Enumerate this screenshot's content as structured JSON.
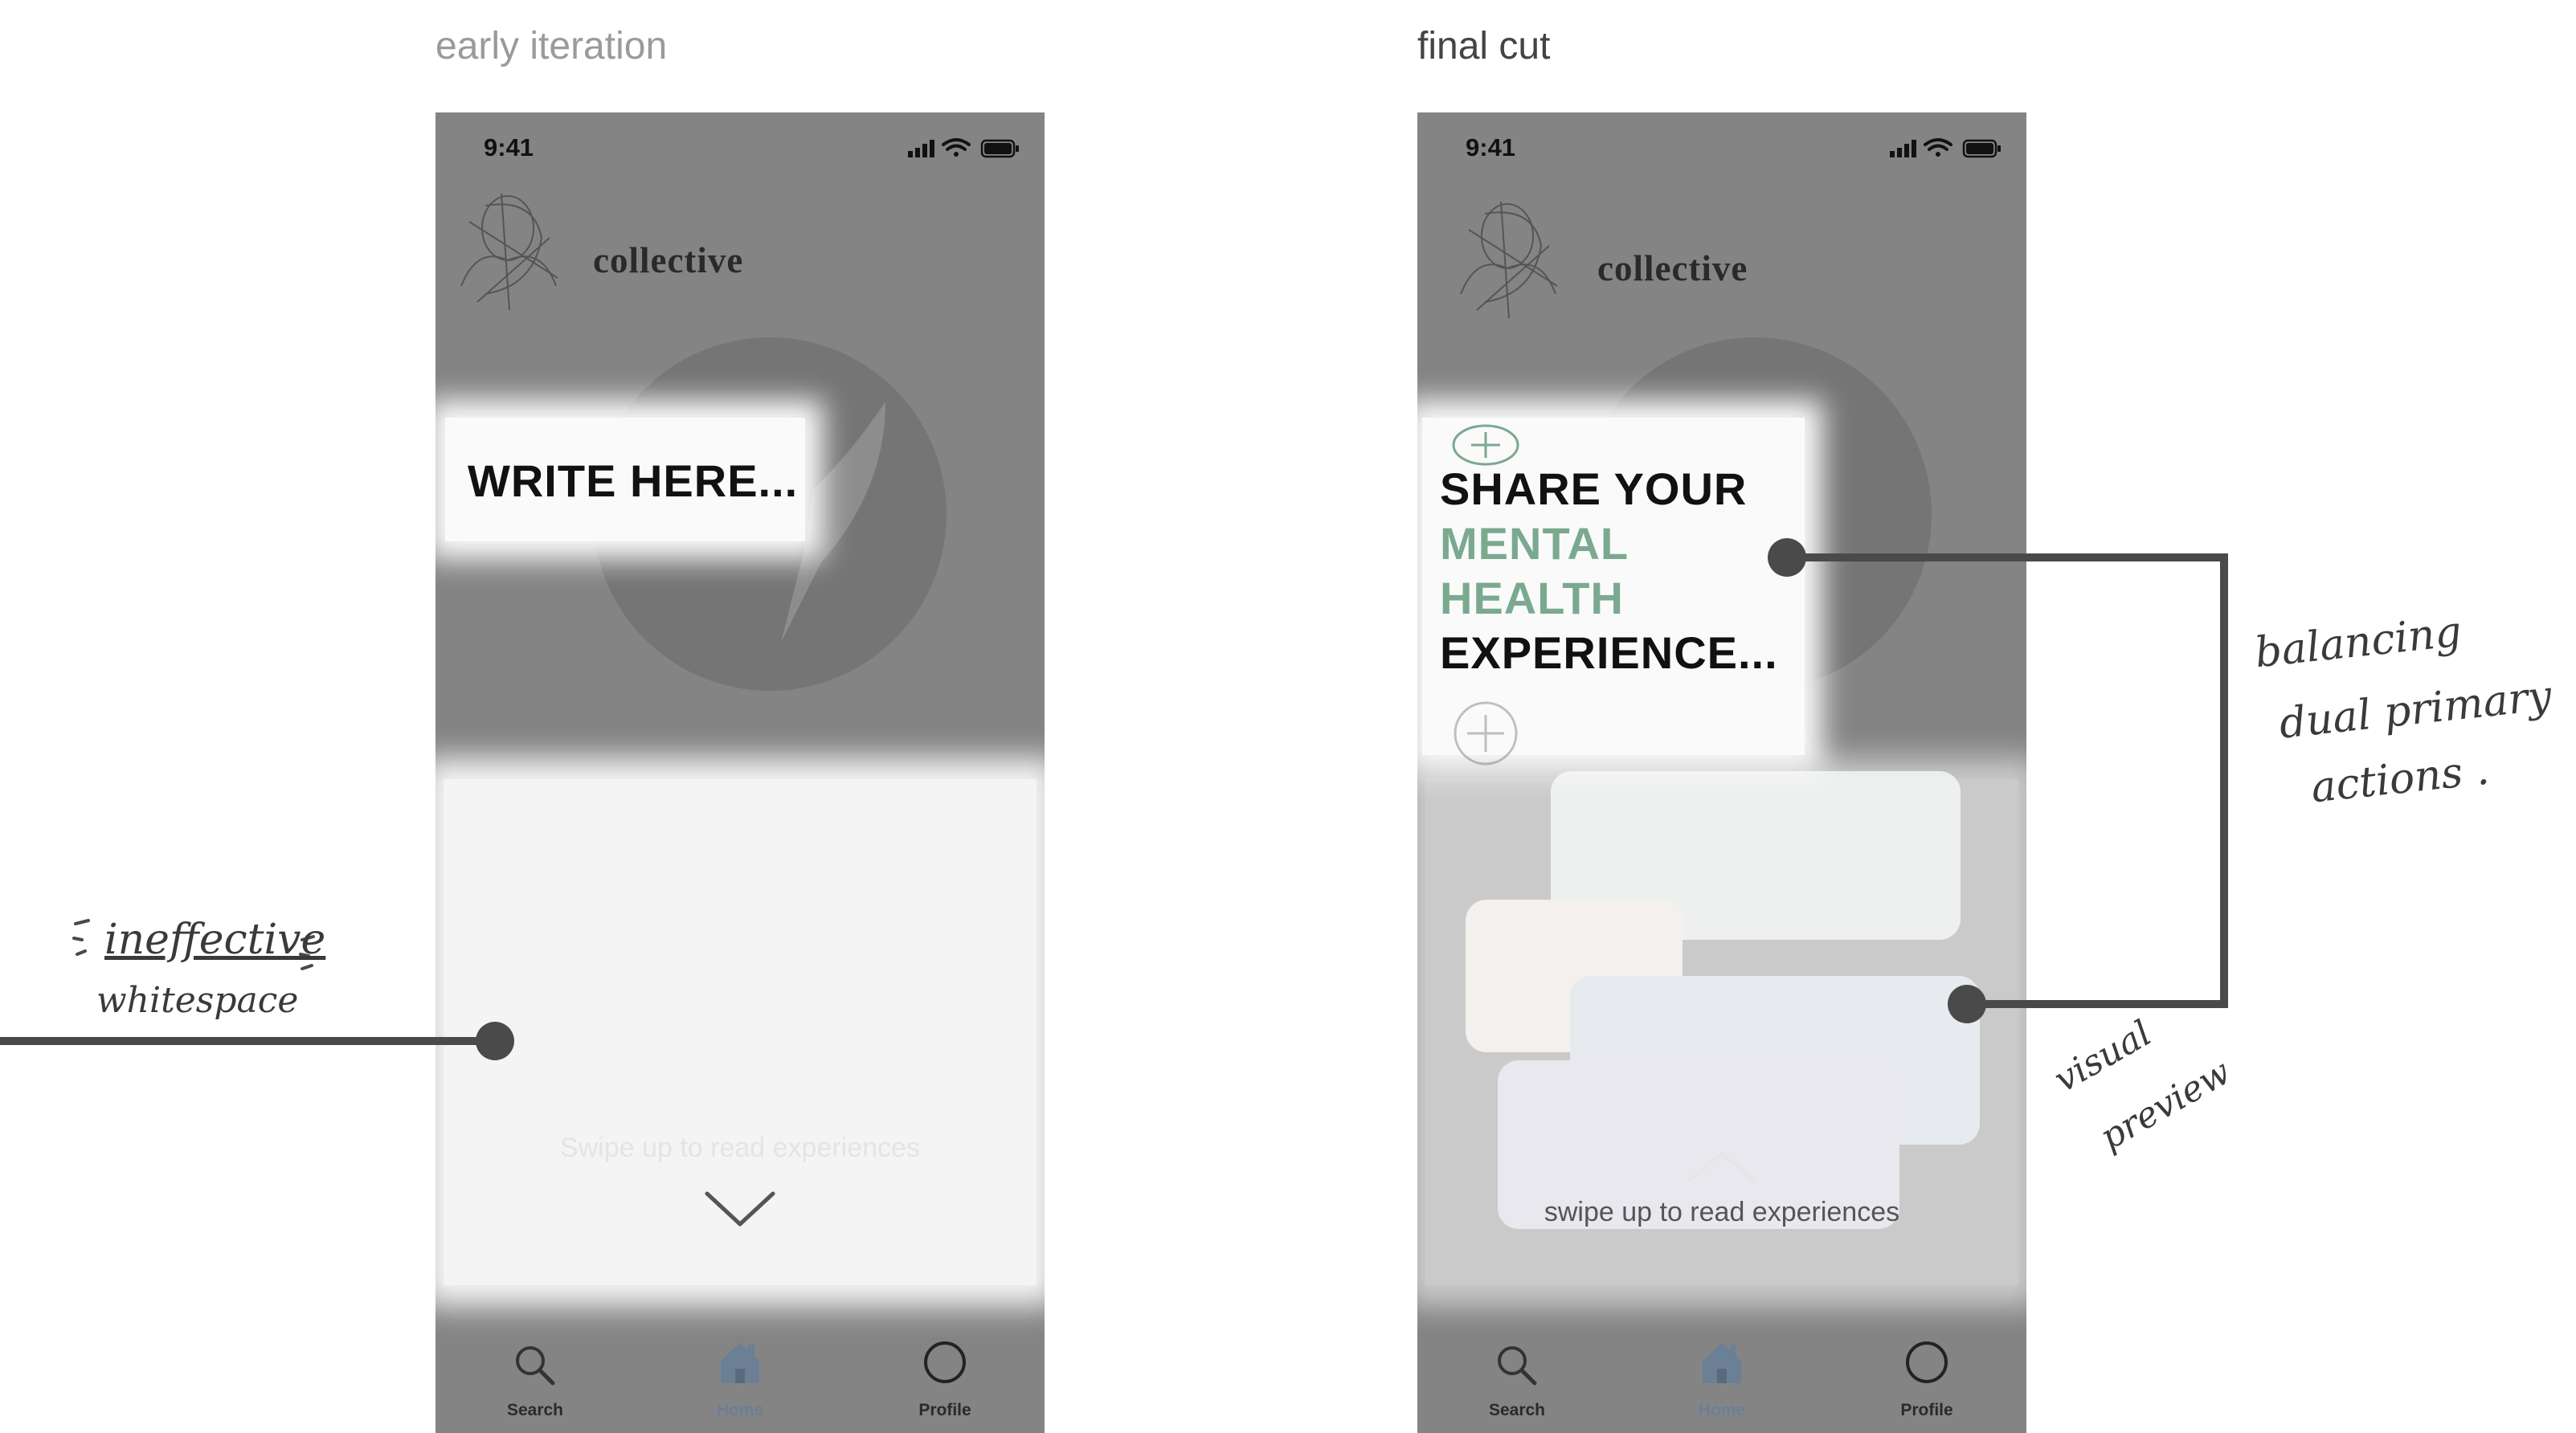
{
  "panels": [
    {
      "title": "early iteration",
      "status_time": "9:41",
      "brand": "collective",
      "prompt": "WRITE HERE...",
      "swipe_hint": "Swipe up to read experiences",
      "tabs": [
        {
          "label": "Search"
        },
        {
          "label": "Home"
        },
        {
          "label": "Profile"
        }
      ]
    },
    {
      "title": "final cut",
      "status_time": "9:41",
      "brand": "collective",
      "prompt_lines": [
        "SHARE YOUR",
        "MENTAL",
        "HEALTH",
        "EXPERIENCE..."
      ],
      "swipe_hint": "swipe up to read experiences",
      "tabs": [
        {
          "label": "Search"
        },
        {
          "label": "Home"
        },
        {
          "label": "Profile"
        }
      ]
    }
  ],
  "annotations": {
    "left": [
      "ineffective",
      "whitespace"
    ],
    "right_top": [
      "balancing",
      "dual primary",
      "actions ."
    ],
    "right_bottom": [
      "visual",
      "preview"
    ]
  },
  "colors": {
    "phone_bg": "#848484",
    "accent_green": "#7aa98f",
    "active_tab": "#6b7f95",
    "callout_line": "#4a4a4a"
  }
}
